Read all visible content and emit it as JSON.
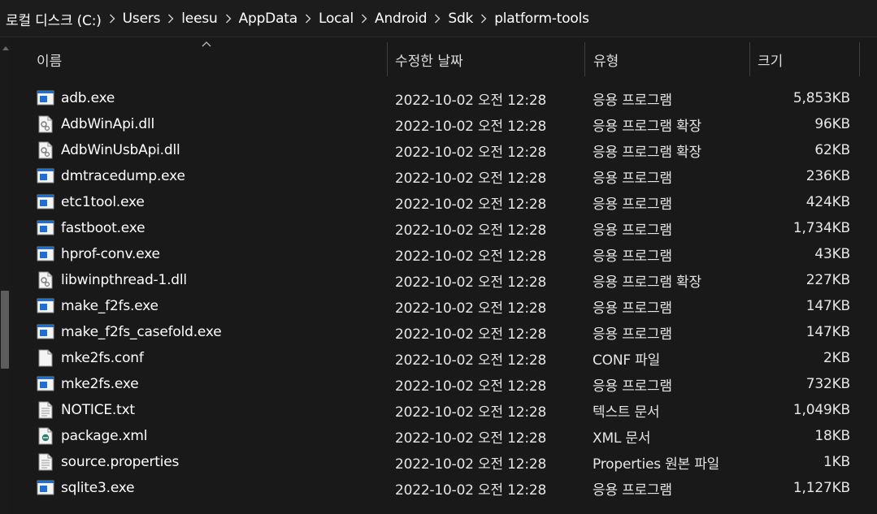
{
  "breadcrumb": {
    "items": [
      "로컬 디스크 (C:)",
      "Users",
      "leesu",
      "AppData",
      "Local",
      "Android",
      "Sdk",
      "platform-tools"
    ]
  },
  "columns": {
    "name": "이름",
    "date": "수정한 날짜",
    "type": "유형",
    "size": "크기"
  },
  "files": [
    {
      "name": "adb.exe",
      "date": "2022-10-02 오전 12:28",
      "type": "응용 프로그램",
      "size": "5,853KB",
      "icon": "exe"
    },
    {
      "name": "AdbWinApi.dll",
      "date": "2022-10-02 오전 12:28",
      "type": "응용 프로그램 확장",
      "size": "96KB",
      "icon": "dll"
    },
    {
      "name": "AdbWinUsbApi.dll",
      "date": "2022-10-02 오전 12:28",
      "type": "응용 프로그램 확장",
      "size": "62KB",
      "icon": "dll"
    },
    {
      "name": "dmtracedump.exe",
      "date": "2022-10-02 오전 12:28",
      "type": "응용 프로그램",
      "size": "236KB",
      "icon": "exe"
    },
    {
      "name": "etc1tool.exe",
      "date": "2022-10-02 오전 12:28",
      "type": "응용 프로그램",
      "size": "424KB",
      "icon": "exe"
    },
    {
      "name": "fastboot.exe",
      "date": "2022-10-02 오전 12:28",
      "type": "응용 프로그램",
      "size": "1,734KB",
      "icon": "exe"
    },
    {
      "name": "hprof-conv.exe",
      "date": "2022-10-02 오전 12:28",
      "type": "응용 프로그램",
      "size": "43KB",
      "icon": "exe"
    },
    {
      "name": "libwinpthread-1.dll",
      "date": "2022-10-02 오전 12:28",
      "type": "응용 프로그램 확장",
      "size": "227KB",
      "icon": "dll"
    },
    {
      "name": "make_f2fs.exe",
      "date": "2022-10-02 오전 12:28",
      "type": "응용 프로그램",
      "size": "147KB",
      "icon": "exe"
    },
    {
      "name": "make_f2fs_casefold.exe",
      "date": "2022-10-02 오전 12:28",
      "type": "응용 프로그램",
      "size": "147KB",
      "icon": "exe"
    },
    {
      "name": "mke2fs.conf",
      "date": "2022-10-02 오전 12:28",
      "type": "CONF 파일",
      "size": "2KB",
      "icon": "blank"
    },
    {
      "name": "mke2fs.exe",
      "date": "2022-10-02 오전 12:28",
      "type": "응용 프로그램",
      "size": "732KB",
      "icon": "exe"
    },
    {
      "name": "NOTICE.txt",
      "date": "2022-10-02 오전 12:28",
      "type": "텍스트 문서",
      "size": "1,049KB",
      "icon": "text"
    },
    {
      "name": "package.xml",
      "date": "2022-10-02 오전 12:28",
      "type": "XML 문서",
      "size": "18KB",
      "icon": "xml"
    },
    {
      "name": "source.properties",
      "date": "2022-10-02 오전 12:28",
      "type": "Properties 원본 파일",
      "size": "1KB",
      "icon": "text"
    },
    {
      "name": "sqlite3.exe",
      "date": "2022-10-02 오전 12:28",
      "type": "응용 프로그램",
      "size": "1,127KB",
      "icon": "exe"
    }
  ],
  "icons": {
    "exe": "application-exe-icon",
    "dll": "settings-dll-icon",
    "blank": "blank-file-icon",
    "text": "text-document-icon",
    "xml": "xml-document-icon"
  },
  "colors": {
    "background": "#191919",
    "text": "#ffffff",
    "exe_icon_accent": "#1f6fd1"
  }
}
